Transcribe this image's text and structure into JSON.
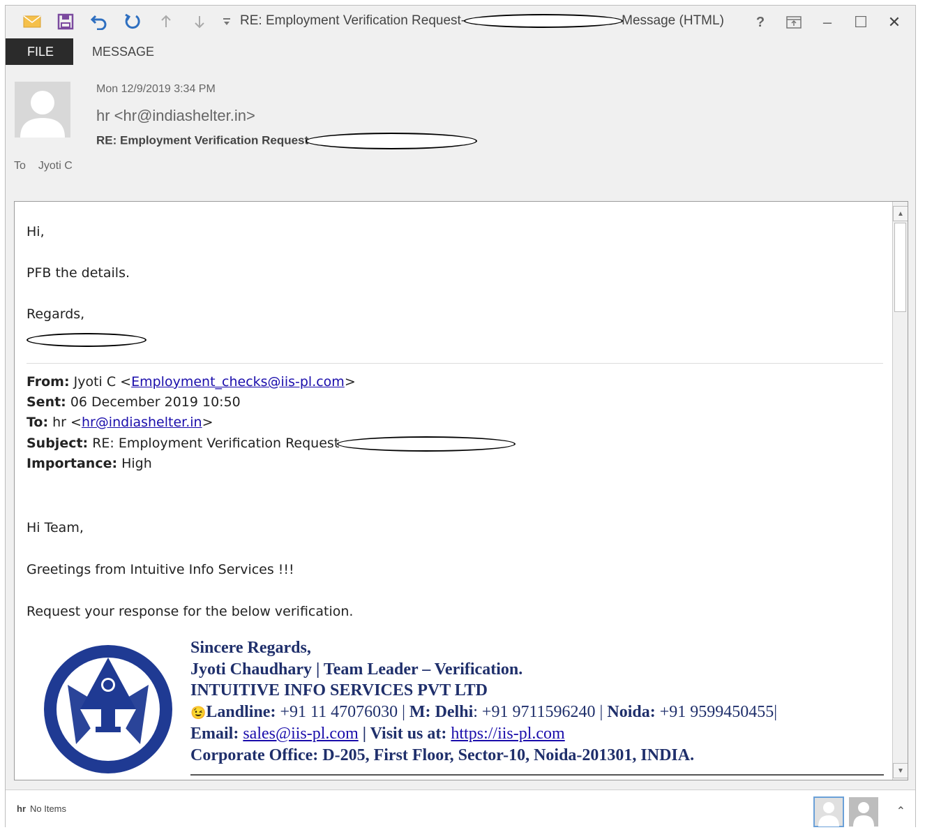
{
  "window": {
    "title_prefix": "RE: Employment Verification Request-",
    "title_suffix": "Message (HTML)"
  },
  "quick_access": [
    "mail-icon",
    "save-icon",
    "undo-icon",
    "redo-icon",
    "up-arrow-icon",
    "down-arrow-icon",
    "customize-icon"
  ],
  "window_controls": {
    "help": "?",
    "ribbon": "restore-ribbon-icon",
    "minimize": "–",
    "maximize": "☐",
    "close": "✕"
  },
  "ribbon": {
    "tabs": [
      "FILE",
      "MESSAGE"
    ]
  },
  "header": {
    "date": "Mon 12/9/2019 3:34 PM",
    "from": "hr <hr@indiashelter.in>",
    "subject": "RE: Employment Verification Request-",
    "to_label": "To",
    "to_value": "Jyoti C"
  },
  "body": {
    "greeting": "Hi,",
    "line1": "PFB the details.",
    "regards": "Regards,",
    "quoted": {
      "from_label": "From:",
      "from_name": " Jyoti C <",
      "from_email": "Employment_checks@iis-pl.com",
      "from_close": ">",
      "sent_label": "Sent:",
      "sent_value": " 06 December 2019 10:50",
      "to_label": "To:",
      "to_name": " hr <",
      "to_email": "hr@indiashelter.in",
      "to_close": ">",
      "subject_label": "Subject:",
      "subject_value": " RE: Employment Verification Request-",
      "importance_label": "Importance:",
      "importance_value": " High"
    },
    "hi_team": "Hi Team,",
    "greetings": "Greetings from Intuitive Info Services !!!",
    "request": "Request your response for the below verification."
  },
  "signature": {
    "line1": "Sincere Regards,",
    "line2": "Jyoti Chaudhary | Team Leader – Verification.",
    "line3": "INTUITIVE INFO SERVICES PVT LTD",
    "landline_label": "Landline:",
    "landline_value": " +91 11 47076030 | ",
    "m_label": "M:",
    "delhi_label": " Delhi",
    "delhi_value": ": +91 9711596240 | ",
    "noida_label": "Noida:",
    "noida_value": " +91 9599450455|",
    "email_label": "Email:",
    "email_value": "sales@iis-pl.com",
    "visit_label": " | Visit us at: ",
    "visit_value": "https://iis-pl.com",
    "office_label": "Corporate Office:",
    "office_value": "  D-205, First Floor, Sector-10, Noida-201301, INDIA."
  },
  "people_pane": {
    "name": "hr",
    "status": "No Items"
  },
  "colors": {
    "brand_blue": "#1f3a93",
    "tab_active": "#2b2b2b",
    "link": "#1a0dab",
    "signature": "#1f2f6b"
  }
}
